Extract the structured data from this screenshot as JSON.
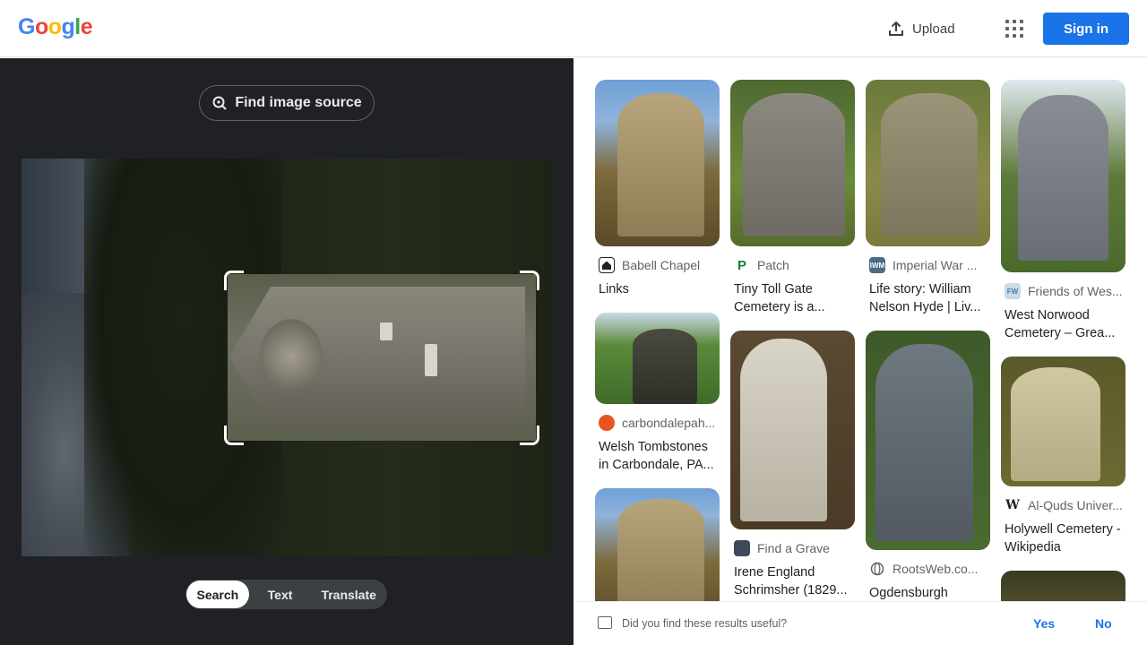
{
  "header": {
    "logo": "Google",
    "upload_label": "Upload",
    "signin_label": "Sign in"
  },
  "left": {
    "find_source_label": "Find image source",
    "modes": [
      "Search",
      "Text",
      "Translate"
    ],
    "active_mode": "Search"
  },
  "results": {
    "columns": [
      [
        {
          "source": "Babell Chapel",
          "title": "Links",
          "icon": "home-icon",
          "icon_color": "#202124"
        },
        {
          "source": "carbondalepah...",
          "title": "Welsh Tombstones in Carbondale, PA...",
          "icon": "site-icon",
          "icon_color": "#e8541b"
        },
        {
          "source": "",
          "title": "",
          "icon": "",
          "icon_color": ""
        }
      ],
      [
        {
          "source": "Patch",
          "title": "Tiny Toll Gate Cemetery is a...",
          "icon": "patch-icon",
          "icon_color": "#188038"
        },
        {
          "source": "Find a Grave",
          "title": "Irene England Schrimsher (1829...",
          "icon": "findagrave-icon",
          "icon_color": "#3c4a5c"
        }
      ],
      [
        {
          "source": "Imperial War ...",
          "title": "Life story: William Nelson Hyde | Liv...",
          "icon": "iwm-icon",
          "icon_color": "#4d6b8a"
        },
        {
          "source": "RootsWeb.co...",
          "title": "Ogdensburgh",
          "icon": "globe-icon",
          "icon_color": "#5f6368"
        }
      ],
      [
        {
          "source": "Friends of Wes...",
          "title": "West Norwood Cemetery – Grea...",
          "icon": "fowc-icon",
          "icon_color": "#7da7c9"
        },
        {
          "source": "Al-Quds Univer...",
          "title": "Holywell Cemetery - Wikipedia",
          "icon": "wikipedia-icon",
          "icon_color": "#202124"
        },
        {
          "source": "",
          "title": "",
          "icon": "",
          "icon_color": ""
        }
      ]
    ]
  },
  "feedback": {
    "question": "Did you find these results useful?",
    "yes": "Yes",
    "no": "No"
  },
  "colors": {
    "accent": "#1a73e8",
    "panel_dark": "#202124"
  }
}
